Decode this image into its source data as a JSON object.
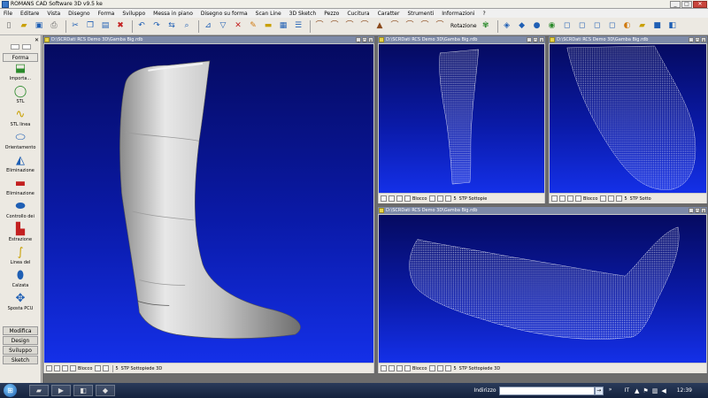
{
  "window": {
    "title": "ROMANS CAD Software 3D v9.5 ke",
    "controls": [
      "_",
      "□",
      "✕"
    ]
  },
  "menu": [
    "File",
    "Editare",
    "Vista",
    "Disegno",
    "Forma",
    "Sviluppo",
    "Messa in piano",
    "Disegno su forma",
    "Scan Line",
    "3D Sketch",
    "Pezzo",
    "Cucitura",
    "Caratter",
    "Strumenti",
    "Informazioni",
    "?"
  ],
  "toolbar": {
    "file_icons": [
      "new-file-icon",
      "open-folder-icon",
      "save-icon",
      "print-icon"
    ],
    "edit_icons": [
      "cut-icon",
      "copy-icon",
      "paste-icon",
      "delete-icon"
    ],
    "rotation_label": "Rotazione",
    "view_icons": [
      "cube-front-icon",
      "cube-side-icon",
      "sphere-icon",
      "color-shade-icon",
      "cube-wire-icon",
      "cube-iso-icon",
      "cube-top-icon",
      "cube-right-icon",
      "shoe-view-icon",
      "folder-icon",
      "cube-dark-icon",
      "cube-light-icon"
    ]
  },
  "left_panel": {
    "active_tab": "Forma",
    "tools": [
      {
        "label": "Importa...",
        "icon": "import-icon"
      },
      {
        "label": "STL",
        "icon": "stl-sphere-icon"
      },
      {
        "label": "STL linea",
        "icon": "stl-line-icon"
      },
      {
        "label": "Orientamento",
        "icon": "orientation-icon"
      },
      {
        "label": "Eliminazione",
        "icon": "eliminate-icon"
      },
      {
        "label": "Eliminazione",
        "icon": "eliminate-2-icon"
      },
      {
        "label": "Controllo dei",
        "icon": "control-icon"
      },
      {
        "label": "Estrazione",
        "icon": "extraction-icon"
      },
      {
        "label": "Linea del",
        "icon": "line-icon"
      },
      {
        "label": "Calzata",
        "icon": "fit-icon"
      },
      {
        "label": "Sposta PCU",
        "icon": "move-pcu-icon"
      }
    ],
    "bottom_tabs": [
      "Modifica",
      "Design",
      "Sviluppo",
      "Sketch"
    ]
  },
  "views": [
    {
      "path": "D:\\SCRDati RCS Demo 3D\\Gamba Big.rdb",
      "status": {
        "block": "Blocco",
        "num": "5",
        "stp": "STP Sottopiede 3D"
      }
    },
    {
      "path": "D:\\SCRDati RCS Demo 3D\\Gamba Big.rdb",
      "status": {
        "block": "Blocco",
        "num": "5",
        "stp": "STP Sottopie"
      }
    },
    {
      "path": "D:\\SCRDati RCS Demo 3D\\Gamba Big.rdb",
      "status": {
        "block": "Blocco",
        "num": "5",
        "stp": "STP Sotto"
      }
    },
    {
      "path": "D:\\SCRDati RCS Demo 3D\\Gamba Big.rdb",
      "status": {
        "block": "Blocco",
        "num": "5",
        "stp": "STP Sottopiede 3D"
      }
    }
  ],
  "taskbar": {
    "address_label": "Indirizzo",
    "address_value": "",
    "language": "IT",
    "clock": "12:39"
  },
  "colors": {
    "viewport_top": "#050a60",
    "viewport_bottom": "#1430e8",
    "model": "#c8c8c8"
  }
}
